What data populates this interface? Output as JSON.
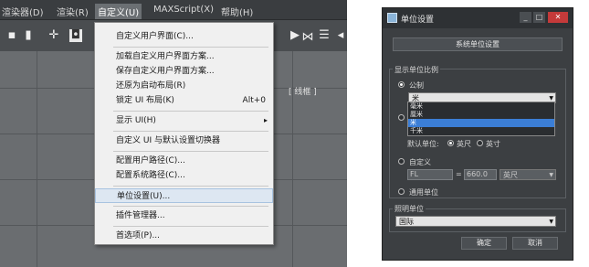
{
  "menubar": {
    "items": [
      "渲染器(D)",
      "渲染(R)",
      "自定义(U)",
      "MAXScript(X)",
      "帮助(H)"
    ]
  },
  "menu": {
    "items": [
      {
        "label": "自定义用户界面(C)...",
        "shortcut": "",
        "arrow": ""
      },
      {
        "label": "加载自定义用户界面方案...",
        "shortcut": "",
        "arrow": ""
      },
      {
        "label": "保存自定义用户界面方案...",
        "shortcut": "",
        "arrow": ""
      },
      {
        "label": "还原为启动布局(R)",
        "shortcut": "",
        "arrow": ""
      },
      {
        "label": "锁定 UI 布局(K)",
        "shortcut": "Alt+0",
        "arrow": ""
      },
      {
        "label": "显示 UI(H)",
        "shortcut": "",
        "arrow": "▸"
      },
      {
        "label": "自定义 UI 与默认设置切换器",
        "shortcut": "",
        "arrow": ""
      },
      {
        "label": "配置用户路径(C)...",
        "shortcut": "",
        "arrow": ""
      },
      {
        "label": "配置系统路径(C)...",
        "shortcut": "",
        "arrow": ""
      },
      {
        "label": "单位设置(U)...",
        "shortcut": "",
        "arrow": ""
      },
      {
        "label": "插件管理器...",
        "shortcut": "",
        "arrow": ""
      },
      {
        "label": "首选项(P)...",
        "shortcut": "",
        "arrow": ""
      }
    ]
  },
  "viewport": {
    "label": "[ 线框 ]"
  },
  "dialog": {
    "title": "单位设置",
    "system_button": "系统单位设置",
    "display_group": "显示单位比例",
    "metric_label": "公制",
    "metric_value": "米",
    "metric_options": [
      "毫米",
      "厘米",
      "米",
      "千米"
    ],
    "selected_option": "米",
    "default_units_label": "默认单位:",
    "feet_label": "英尺",
    "inch_label": "英寸",
    "custom_label": "自定义",
    "custom_field1": "FL",
    "custom_equals": "=",
    "custom_value": "660.0",
    "custom_unit": "英尺",
    "generic_label": "通用单位",
    "lighting_group": "照明单位",
    "lighting_value": "国际",
    "ok": "确定",
    "cancel": "取消",
    "minimize": "_",
    "maximize": "□",
    "close": "✕"
  },
  "colors": {
    "menu_bg": "#f0f0f0",
    "dialog_bg": "#3c3f42",
    "selection": "#3b7ed6"
  }
}
